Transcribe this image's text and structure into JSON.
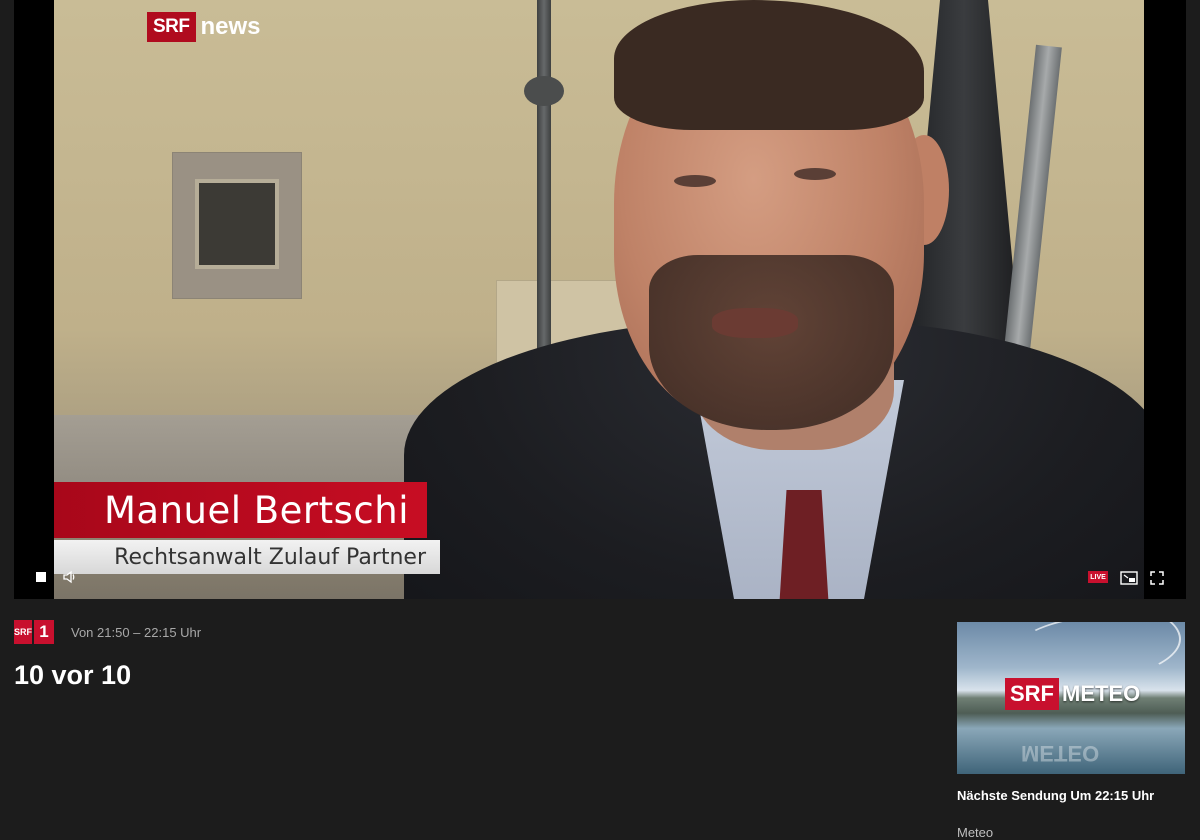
{
  "player": {
    "channel_logo": {
      "box": "SRF",
      "word": "news"
    },
    "lower_third": {
      "name": "Manuel Bertschi",
      "role": "Rechtsanwalt Zulauf Partner"
    },
    "controls": {
      "stop_icon": "stop-icon",
      "volume_icon": "speaker-icon",
      "live_badge": "LIVE",
      "cast_icon": "picture-in-picture-icon",
      "fullscreen_icon": "fullscreen-icon"
    }
  },
  "program": {
    "channel": {
      "line1": "SRF",
      "line2": "1"
    },
    "time_range": "Von 21:50 – 22:15 Uhr",
    "title": "10 vor 10"
  },
  "next": {
    "thumbnail": {
      "box": "SRF",
      "word": "METEO",
      "reflection": "METEO"
    },
    "label": "Nächste Sendung Um 22:15 Uhr",
    "title": "Meteo"
  },
  "colors": {
    "background": "#1c1c1c",
    "brand_red": "#c8102e",
    "muted_text": "#a8a8a8"
  }
}
